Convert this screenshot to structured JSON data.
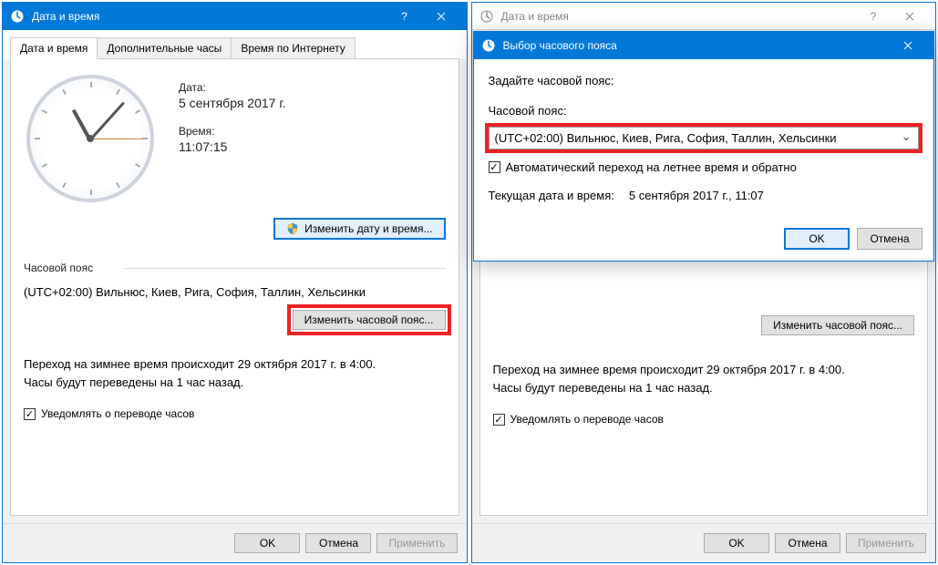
{
  "leftWindow": {
    "title": "Дата и время",
    "tabs": [
      "Дата и время",
      "Дополнительные часы",
      "Время по Интернету"
    ],
    "dateLabel": "Дата:",
    "dateValue": "5 сентября 2017 г.",
    "timeLabel": "Время:",
    "timeValue": "11:07:15",
    "changeBtn": "Изменить дату и время...",
    "tzSection": "Часовой пояс",
    "tzValue": "(UTC+02:00) Вильнюс, Киев, Рига, София, Таллин, Хельсинки",
    "changeTzBtn": "Изменить часовой пояс...",
    "dstText1": "Переход на зимнее время происходит 29 октября 2017 г. в 4:00.",
    "dstText2": "Часы будут переведены на 1 час назад.",
    "notifyCheck": "Уведомлять о переводе часов",
    "okBtn": "OK",
    "cancelBtn": "Отмена",
    "applyBtn": "Применить"
  },
  "rightWindow": {
    "title": "Дата и время",
    "innerTitle": "Выбор часового пояса",
    "innerPrompt": "Задайте часовой пояс:",
    "tzLabel": "Часовой пояс:",
    "tzSelect": "(UTC+02:00) Вильнюс, Киев, Рига, София, Таллин, Хельсинки",
    "autoDst": "Автоматический переход на летнее время и обратно",
    "currLabel": "Текущая дата и время:",
    "currValue": "5 сентября 2017 г., 11:07",
    "okBtn": "OK",
    "cancelBtn": "Отмена",
    "changeTzBtn": "Изменить часовой пояс...",
    "dstText1": "Переход на зимнее время происходит 29 октября 2017 г. в 4:00.",
    "dstText2": "Часы будут переведены на 1 час назад.",
    "notifyCheck": "Уведомлять о переводе часов",
    "applyBtn": "Применить"
  }
}
